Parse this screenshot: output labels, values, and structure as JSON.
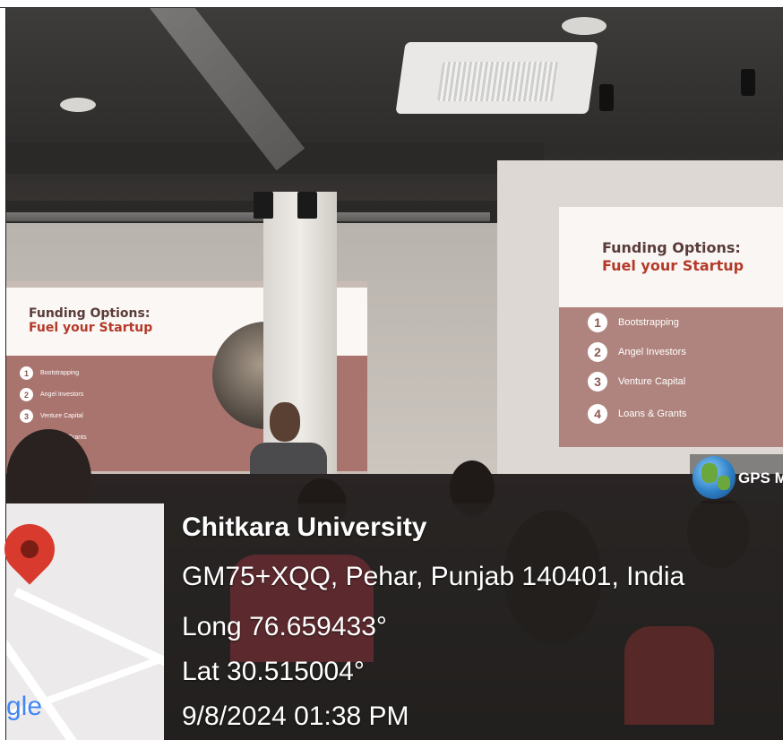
{
  "slide_left": {
    "title_line1": "Funding Options:",
    "title_line2": "Fuel your Startup",
    "items": [
      {
        "num": "1",
        "label": "Bootstrapping"
      },
      {
        "num": "2",
        "label": "Angel Investors"
      },
      {
        "num": "3",
        "label": "Venture Capital"
      },
      {
        "num": "",
        "label": "& Grants"
      }
    ]
  },
  "slide_right": {
    "title_line1": "Funding Options:",
    "title_line2": "Fuel your Startup",
    "items": [
      {
        "num": "1",
        "label": "Bootstrapping"
      },
      {
        "num": "2",
        "label": "Angel Investors"
      },
      {
        "num": "3",
        "label": "Venture Capital"
      },
      {
        "num": "4",
        "label": "Loans & Grants"
      }
    ]
  },
  "gps": {
    "badge": "GPS M",
    "place": "Chitkara University",
    "address": "GM75+XQQ, Pehar, Punjab 140401, India",
    "longitude": "Long 76.659433°",
    "latitude": "Lat 30.515004°",
    "datetime": "9/8/2024 01:38 PM",
    "map_logo_fragment": "gle"
  },
  "colors": {
    "slide_title_dark": "#5a3c3a",
    "slide_title_red": "#b43a2a",
    "slide_body": "#b0847e",
    "pin": "#d93a2e",
    "overlay_text": "#ffffff"
  }
}
